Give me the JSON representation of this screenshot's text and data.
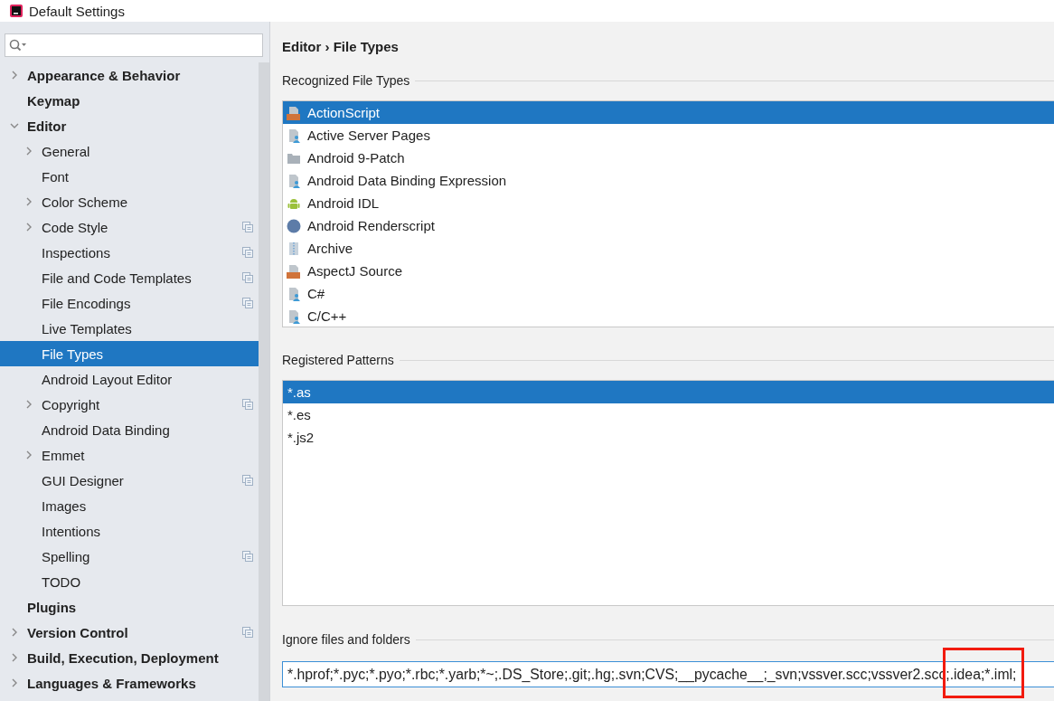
{
  "window": {
    "title": "Default Settings"
  },
  "sidebar": {
    "items": [
      {
        "label": "Appearance & Behavior",
        "expanded": false
      },
      {
        "label": "Keymap"
      },
      {
        "label": "Editor",
        "expanded": true,
        "children": [
          {
            "label": "General",
            "expanded": false,
            "selected": false,
            "project_level": false
          },
          {
            "label": "Font",
            "selected": false,
            "project_level": false
          },
          {
            "label": "Color Scheme",
            "expanded": false,
            "selected": false,
            "project_level": false
          },
          {
            "label": "Code Style",
            "expanded": false,
            "selected": false,
            "project_level": true
          },
          {
            "label": "Inspections",
            "selected": false,
            "project_level": true
          },
          {
            "label": "File and Code Templates",
            "selected": false,
            "project_level": true
          },
          {
            "label": "File Encodings",
            "selected": false,
            "project_level": true
          },
          {
            "label": "Live Templates",
            "selected": false,
            "project_level": false
          },
          {
            "label": "File Types",
            "selected": true,
            "project_level": false
          },
          {
            "label": "Android Layout Editor",
            "selected": false,
            "project_level": false
          },
          {
            "label": "Copyright",
            "expanded": false,
            "selected": false,
            "project_level": true
          },
          {
            "label": "Android Data Binding",
            "selected": false,
            "project_level": false
          },
          {
            "label": "Emmet",
            "expanded": false,
            "selected": false,
            "project_level": false
          },
          {
            "label": "GUI Designer",
            "selected": false,
            "project_level": true
          },
          {
            "label": "Images",
            "selected": false,
            "project_level": false
          },
          {
            "label": "Intentions",
            "selected": false,
            "project_level": false
          },
          {
            "label": "Spelling",
            "selected": false,
            "project_level": true
          },
          {
            "label": "TODO",
            "selected": false,
            "project_level": false
          }
        ]
      },
      {
        "label": "Plugins"
      },
      {
        "label": "Version Control",
        "expanded": false,
        "project_level": true
      },
      {
        "label": "Build, Execution, Deployment",
        "expanded": false
      },
      {
        "label": "Languages & Frameworks",
        "expanded": false
      }
    ]
  },
  "breadcrumb": {
    "parent": "Editor",
    "separator": "›",
    "current": "File Types"
  },
  "recognized": {
    "title": "Recognized File Types",
    "items": [
      {
        "label": "ActionScript",
        "kind": "tagged",
        "selected": true
      },
      {
        "label": "Active Server Pages",
        "kind": "plain",
        "selected": false
      },
      {
        "label": "Android 9-Patch",
        "kind": "folder",
        "selected": false
      },
      {
        "label": "Android Data Binding Expression",
        "kind": "plain",
        "selected": false
      },
      {
        "label": "Android IDL",
        "kind": "android",
        "selected": false
      },
      {
        "label": "Android Renderscript",
        "kind": "round",
        "selected": false
      },
      {
        "label": "Archive",
        "kind": "archive",
        "selected": false
      },
      {
        "label": "AspectJ Source",
        "kind": "tagged",
        "selected": false
      },
      {
        "label": "C#",
        "kind": "plain",
        "selected": false
      },
      {
        "label": "C/C++",
        "kind": "plain",
        "selected": false
      }
    ]
  },
  "patterns": {
    "title": "Registered Patterns",
    "items": [
      {
        "label": "*.as",
        "selected": true
      },
      {
        "label": "*.es",
        "selected": false
      },
      {
        "label": "*.js2",
        "selected": false
      }
    ]
  },
  "ignore": {
    "title": "Ignore files and folders",
    "value": "*.hprof;*.pyc;*.pyo;*.rbc;*.yarb;*~;.DS_Store;.git;.hg;.svn;CVS;__pycache__;_svn;vssver.scc;vssver2.scc;.idea;*.iml;",
    "highlighted": true
  }
}
